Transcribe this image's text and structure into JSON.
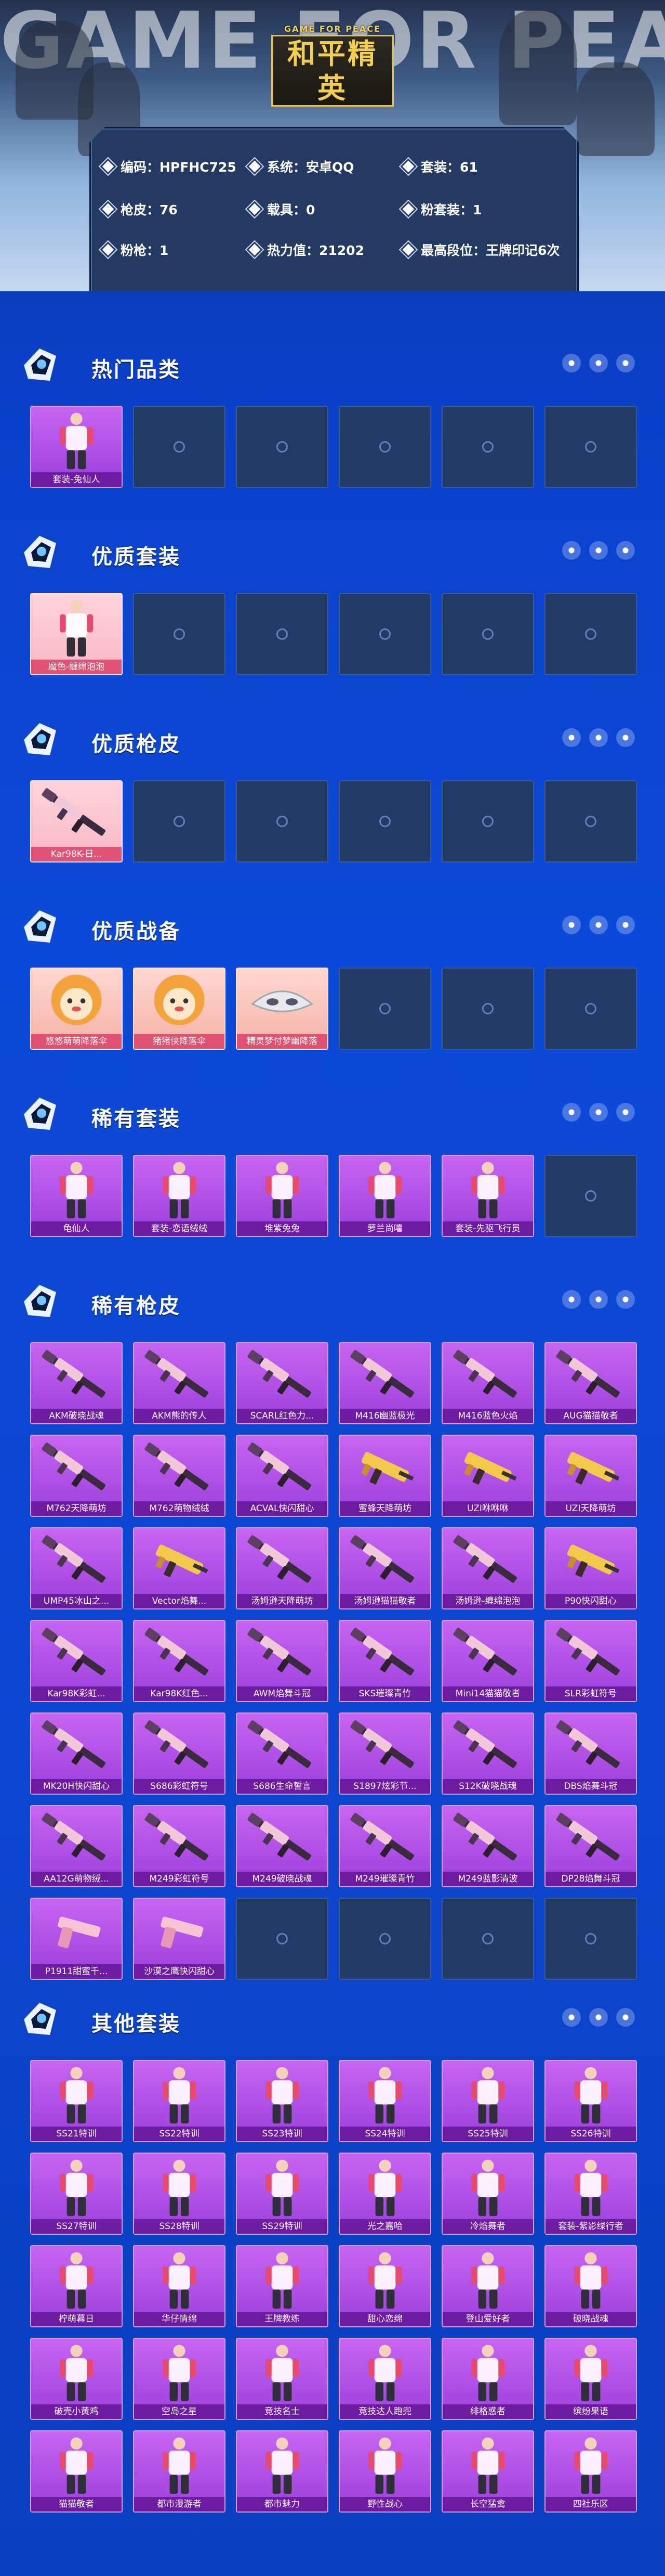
{
  "header": {
    "bg_word": "GAME FOR PEACE",
    "logo_sub": "GAME FOR PEACE",
    "logo_main": "和平精英",
    "info": [
      {
        "label": "编码：HPFHC725"
      },
      {
        "label": "系统：安卓QQ"
      },
      {
        "label": "套装：61"
      },
      {
        "label": "枪皮：76"
      },
      {
        "label": "载具：0"
      },
      {
        "label": "粉套装：1"
      },
      {
        "label": "粉枪：1"
      },
      {
        "label": "热力值：21202"
      },
      {
        "label": "最高段位：王牌印记6次"
      }
    ]
  },
  "colors": {
    "accent_blue": "#0b46cf",
    "item_purple": "#b04ee8",
    "item_pink": "#f7b7c6"
  },
  "sections": [
    {
      "title": "热门品类",
      "items": [
        {
          "label": "套装-兔仙人",
          "kind": "item",
          "icon": "outfit-icon"
        }
      ],
      "slots": 6
    },
    {
      "title": "优质套装",
      "items": [
        {
          "label": "魔色-缠绵泡泡",
          "kind": "pink",
          "icon": "outfit-icon"
        }
      ],
      "slots": 6
    },
    {
      "title": "优质枪皮",
      "items": [
        {
          "label": "Kar98K-日...",
          "kind": "pink",
          "icon": "rifle-icon"
        }
      ],
      "slots": 6
    },
    {
      "title": "优质战备",
      "items": [
        {
          "label": "悠悠萌萌降落伞",
          "kind": "orange",
          "icon": "parachute-icon"
        },
        {
          "label": "猪猪侠降落伞",
          "kind": "orange",
          "icon": "parachute-icon"
        },
        {
          "label": "精灵梦付梦幽降落",
          "kind": "orange",
          "icon": "mask-icon"
        }
      ],
      "slots": 6
    },
    {
      "title": "稀有套装",
      "items": [
        {
          "label": "龟仙人",
          "kind": "item",
          "icon": "outfit-icon"
        },
        {
          "label": "套装-恋语绒绒",
          "kind": "item",
          "icon": "outfit-icon"
        },
        {
          "label": "堆紫兔兔",
          "kind": "item",
          "icon": "outfit-icon"
        },
        {
          "label": "萝兰尚嚯",
          "kind": "item",
          "icon": "outfit-icon"
        },
        {
          "label": "套装-先驱飞行员",
          "kind": "item",
          "icon": "outfit-icon"
        }
      ],
      "slots": 6
    },
    {
      "title": "稀有枪皮",
      "items": [
        {
          "label": "AKM破晓战魂",
          "kind": "item",
          "icon": "rifle-icon"
        },
        {
          "label": "AKM熊的传人",
          "kind": "item",
          "icon": "rifle-icon"
        },
        {
          "label": "SCARL红色力...",
          "kind": "item",
          "icon": "rifle-icon"
        },
        {
          "label": "M416幽蓝极光",
          "kind": "item",
          "icon": "rifle-icon"
        },
        {
          "label": "M416蓝色火焰",
          "kind": "item",
          "icon": "rifle-icon"
        },
        {
          "label": "AUG猫猫敬者",
          "kind": "item",
          "icon": "rifle-icon"
        },
        {
          "label": "M762天降萌坊",
          "kind": "item",
          "icon": "rifle-icon"
        },
        {
          "label": "M762萌物绒绒",
          "kind": "item",
          "icon": "rifle-icon"
        },
        {
          "label": "ACVAL快闪甜心",
          "kind": "item",
          "icon": "rifle-icon"
        },
        {
          "label": "蜜蜂天降萌坊",
          "kind": "item",
          "icon": "smg-icon"
        },
        {
          "label": "UZI咻咻咻",
          "kind": "item",
          "icon": "smg-icon"
        },
        {
          "label": "UZI天降萌坊",
          "kind": "item",
          "icon": "smg-icon"
        },
        {
          "label": "UMP45冰山之...",
          "kind": "item",
          "icon": "rifle-icon"
        },
        {
          "label": "Vector焰舞...",
          "kind": "item",
          "icon": "smg-icon"
        },
        {
          "label": "汤姆逊天降萌坊",
          "kind": "item",
          "icon": "rifle-icon"
        },
        {
          "label": "汤姆逊猫猫敬者",
          "kind": "item",
          "icon": "rifle-icon"
        },
        {
          "label": "汤姆逊-缠绵泡泡",
          "kind": "item",
          "icon": "rifle-icon"
        },
        {
          "label": "P90快闪甜心",
          "kind": "item",
          "icon": "smg-icon"
        },
        {
          "label": "Kar98K彩虹...",
          "kind": "item",
          "icon": "rifle-icon"
        },
        {
          "label": "Kar98K红色...",
          "kind": "item",
          "icon": "rifle-icon"
        },
        {
          "label": "AWM焰舞斗冠",
          "kind": "item",
          "icon": "rifle-icon"
        },
        {
          "label": "SKS璀璨青竹",
          "kind": "item",
          "icon": "rifle-icon"
        },
        {
          "label": "Mini14猫猫敬者",
          "kind": "item",
          "icon": "rifle-icon"
        },
        {
          "label": "SLR彩虹符号",
          "kind": "item",
          "icon": "rifle-icon"
        },
        {
          "label": "MK20H快闪甜心",
          "kind": "item",
          "icon": "rifle-icon"
        },
        {
          "label": "S686彩虹符号",
          "kind": "item",
          "icon": "rifle-icon"
        },
        {
          "label": "S686生命誓言",
          "kind": "item",
          "icon": "rifle-icon"
        },
        {
          "label": "S1897炫彩节...",
          "kind": "item",
          "icon": "rifle-icon"
        },
        {
          "label": "S12K破晓战魂",
          "kind": "item",
          "icon": "rifle-icon"
        },
        {
          "label": "DBS焰舞斗冠",
          "kind": "item",
          "icon": "rifle-icon"
        },
        {
          "label": "AA12G萌物绒...",
          "kind": "item",
          "icon": "rifle-icon"
        },
        {
          "label": "M249彩虹符号",
          "kind": "item",
          "icon": "rifle-icon"
        },
        {
          "label": "M249破晓战魂",
          "kind": "item",
          "icon": "rifle-icon"
        },
        {
          "label": "M249璀璨青竹",
          "kind": "item",
          "icon": "rifle-icon"
        },
        {
          "label": "M249蓝影清波",
          "kind": "item",
          "icon": "rifle-icon"
        },
        {
          "label": "DP28焰舞斗冠",
          "kind": "item",
          "icon": "rifle-icon"
        },
        {
          "label": "P1911甜蜜千...",
          "kind": "item",
          "icon": "pistol-icon"
        },
        {
          "label": "沙漠之鹰快闪甜心",
          "kind": "item",
          "icon": "pistol-icon"
        }
      ],
      "slots": 42
    },
    {
      "title": "其他套装",
      "items": [
        {
          "label": "SS21特训",
          "kind": "item",
          "icon": "outfit-icon"
        },
        {
          "label": "SS22特训",
          "kind": "item",
          "icon": "outfit-icon"
        },
        {
          "label": "SS23特训",
          "kind": "item",
          "icon": "outfit-icon"
        },
        {
          "label": "SS24特训",
          "kind": "item",
          "icon": "outfit-icon"
        },
        {
          "label": "SS25特训",
          "kind": "item",
          "icon": "outfit-icon"
        },
        {
          "label": "SS26特训",
          "kind": "item",
          "icon": "outfit-icon"
        },
        {
          "label": "SS27特训",
          "kind": "item",
          "icon": "outfit-icon"
        },
        {
          "label": "SS28特训",
          "kind": "item",
          "icon": "outfit-icon"
        },
        {
          "label": "SS29特训",
          "kind": "item",
          "icon": "outfit-icon"
        },
        {
          "label": "光之嘉哈",
          "kind": "item",
          "icon": "outfit-icon"
        },
        {
          "label": "冷焰舞者",
          "kind": "item",
          "icon": "outfit-icon"
        },
        {
          "label": "套装-紫影绿行者",
          "kind": "item",
          "icon": "outfit-icon"
        },
        {
          "label": "柠萌暮日",
          "kind": "item",
          "icon": "outfit-icon"
        },
        {
          "label": "华仔情绵",
          "kind": "item",
          "icon": "outfit-icon"
        },
        {
          "label": "王牌教练",
          "kind": "item",
          "icon": "outfit-icon"
        },
        {
          "label": "甜心恋绵",
          "kind": "item",
          "icon": "outfit-icon"
        },
        {
          "label": "登山爱好者",
          "kind": "item",
          "icon": "outfit-icon"
        },
        {
          "label": "破晓战魂",
          "kind": "item",
          "icon": "outfit-icon"
        },
        {
          "label": "破壳小黄鸡",
          "kind": "item",
          "icon": "outfit-icon"
        },
        {
          "label": "空岛之星",
          "kind": "item",
          "icon": "outfit-icon"
        },
        {
          "label": "竞技名士",
          "kind": "item",
          "icon": "outfit-icon"
        },
        {
          "label": "竞技达人跑兜",
          "kind": "item",
          "icon": "outfit-icon"
        },
        {
          "label": "绯格惑者",
          "kind": "item",
          "icon": "outfit-icon"
        },
        {
          "label": "缤纷果语",
          "kind": "item",
          "icon": "outfit-icon"
        },
        {
          "label": "猫猫敬者",
          "kind": "item",
          "icon": "outfit-icon"
        },
        {
          "label": "都市漫游者",
          "kind": "item",
          "icon": "outfit-icon"
        },
        {
          "label": "都市魅力",
          "kind": "item",
          "icon": "outfit-icon"
        },
        {
          "label": "野性战心",
          "kind": "item",
          "icon": "outfit-icon"
        },
        {
          "label": "长空猛禽",
          "kind": "item",
          "icon": "outfit-icon"
        },
        {
          "label": "四社乐区",
          "kind": "item",
          "icon": "outfit-icon"
        }
      ],
      "slots": 30
    }
  ]
}
